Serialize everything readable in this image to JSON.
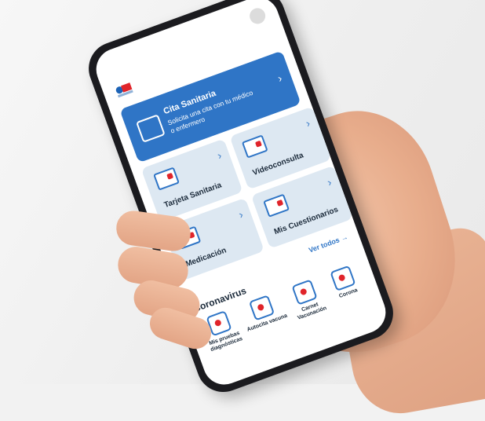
{
  "header": {
    "logo_icon": "madrid-health-logo",
    "camera_icon": "front-camera-icon"
  },
  "cita_card": {
    "title": "Cita Sanitaria",
    "subtitle": "Solicita una cita con tu médico o enfermero",
    "icon": "calendar-icon"
  },
  "tiles": [
    {
      "label": "Tarjeta Sanitaria",
      "icon": "health-card-icon"
    },
    {
      "label": "Videoconsulta",
      "icon": "video-camera-icon"
    },
    {
      "label": "Medicación",
      "icon": "medication-icon"
    },
    {
      "label": "Mis Cuestionarios",
      "icon": "questionnaire-icon"
    }
  ],
  "coronavirus": {
    "title": "Coronavirus",
    "see_all": "Ver todos",
    "items": [
      {
        "label": "Mis pruebas diagnósticas",
        "icon": "test-flask-icon"
      },
      {
        "label": "Autocita vacuna",
        "icon": "vaccine-calendar-icon"
      },
      {
        "label": "Carnet Vacunación",
        "icon": "vaccination-card-icon"
      },
      {
        "label": "Corona",
        "icon": "virus-icon"
      }
    ]
  },
  "colors": {
    "accent_blue": "#2f75c6",
    "tile_background": "#dde8f2",
    "accent_red": "#e0242a"
  }
}
